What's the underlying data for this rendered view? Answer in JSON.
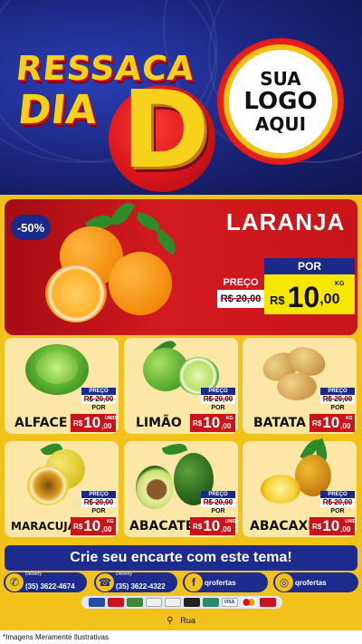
{
  "header": {
    "title_line1": "RESSACA",
    "title_line2": "DIA",
    "title_big": "D",
    "logo_line1": "SUA",
    "logo_line2": "LOGO",
    "logo_line3": "AQUI"
  },
  "hero": {
    "discount": "-50%",
    "name": "LARANJA",
    "old_label": "PREÇO",
    "old_price": "R$ 20,00",
    "por_label": "POR",
    "currency": "R$",
    "price_int": "10",
    "price_dec": ",00",
    "unit": "KG"
  },
  "products": [
    {
      "name": "ALFACE",
      "old_label": "PREÇO",
      "old_price": "R$ 20,00",
      "por_label": "POR",
      "currency": "R$",
      "price_int": "10",
      "price_dec": ",00",
      "unit": "UNID"
    },
    {
      "name": "LIMÃO",
      "old_label": "PREÇO",
      "old_price": "R$ 20,00",
      "por_label": "POR",
      "currency": "R$",
      "price_int": "10",
      "price_dec": ",00",
      "unit": "KG"
    },
    {
      "name": "BATATA",
      "old_label": "PREÇO",
      "old_price": "R$ 20,00",
      "por_label": "POR",
      "currency": "R$",
      "price_int": "10",
      "price_dec": ",00",
      "unit": "KG"
    },
    {
      "name": "MARACUJÁ",
      "old_label": "PREÇO",
      "old_price": "R$ 20,00",
      "por_label": "POR",
      "currency": "R$",
      "price_int": "10",
      "price_dec": ",00",
      "unit": "KG"
    },
    {
      "name": "ABACATE",
      "old_label": "PREÇO",
      "old_price": "R$ 20,00",
      "por_label": "POR",
      "currency": "R$",
      "price_int": "10",
      "price_dec": ",00",
      "unit": "UNID"
    },
    {
      "name": "ABACAXI",
      "old_label": "PREÇO",
      "old_price": "R$ 20,00",
      "por_label": "POR",
      "currency": "R$",
      "price_int": "10",
      "price_dec": ",00",
      "unit": "UNID"
    }
  ],
  "cta": {
    "label": "Crie seu encarte com este tema!"
  },
  "contacts": {
    "whatsapp_label": "Delivery",
    "whatsapp_number": "(35) 3622-4674",
    "phone_label": "Delivery",
    "phone_number": "(35) 3622-4322",
    "facebook_handle": "qrofertas",
    "instagram_handle": "qrofertas"
  },
  "payments": [
    "card-icon",
    "card-icon",
    "card-icon",
    "card-icon",
    "card-icon",
    "card-icon",
    "card-icon",
    "visa",
    "mastercard",
    "hipercard"
  ],
  "payment_labels": {
    "visa": "VISA"
  },
  "address": {
    "label": "Rua"
  },
  "footer": {
    "note": "*Imagens Meramente Ilustrativas"
  },
  "colors": {
    "blue": "#1d2b8f",
    "red": "#c8141a",
    "yellow": "#f2c21a",
    "card": "#fde7a6"
  }
}
